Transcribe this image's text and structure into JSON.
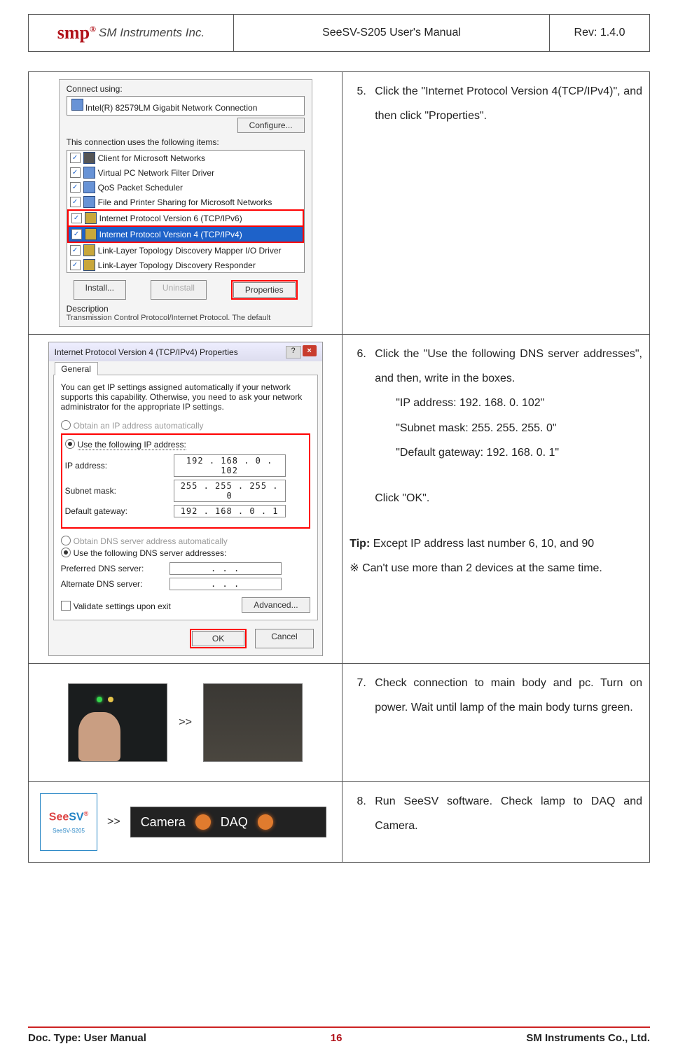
{
  "header": {
    "logo_brand": "smp",
    "logo_text": "SM Instruments Inc.",
    "title": "SeeSV-S205 User's Manual",
    "revision": "Rev: 1.4.0"
  },
  "dialog1": {
    "connect_using_label": "Connect using:",
    "adapter": "Intel(R) 82579LM Gigabit Network Connection",
    "configure_btn": "Configure...",
    "items_label": "This connection uses the following items:",
    "items": [
      "Client for Microsoft Networks",
      "Virtual PC Network Filter Driver",
      "QoS Packet Scheduler",
      "File and Printer Sharing for Microsoft Networks",
      "Internet Protocol Version 6 (TCP/IPv6)",
      "Internet Protocol Version 4 (TCP/IPv4)",
      "Link-Layer Topology Discovery Mapper I/O Driver",
      "Link-Layer Topology Discovery Responder"
    ],
    "install_btn": "Install...",
    "uninstall_btn": "Uninstall",
    "properties_btn": "Properties",
    "description_label": "Description",
    "description_text": "Transmission Control Protocol/Internet Protocol. The default"
  },
  "step5": {
    "num": "5.",
    "text": "Click the \"Internet Protocol Version 4(TCP/IPv4)\", and then click \"Properties\"."
  },
  "dialog2": {
    "title": "Internet Protocol Version 4 (TCP/IPv4) Properties",
    "tab": "General",
    "intro": "You can get IP settings assigned automatically if your network supports this capability. Otherwise, you need to ask your network administrator for the appropriate IP settings.",
    "obtain_ip": "Obtain an IP address automatically",
    "use_ip": "Use the following IP address:",
    "ip_label": "IP address:",
    "ip_value": "192 . 168 .  0   . 102",
    "subnet_label": "Subnet mask:",
    "subnet_value": "255 . 255 . 255 .  0",
    "gateway_label": "Default gateway:",
    "gateway_value": "192 . 168 .  0   .  1",
    "obtain_dns": "Obtain DNS server address automatically",
    "use_dns": "Use the following DNS server addresses:",
    "preferred_label": "Preferred DNS server:",
    "alternate_label": "Alternate DNS server:",
    "empty_ip": ".       .       .",
    "validate": "Validate settings upon exit",
    "advanced_btn": "Advanced...",
    "ok_btn": "OK",
    "cancel_btn": "Cancel"
  },
  "step6": {
    "num": "6.",
    "line1": "Click the \"Use the following DNS server addresses\", and then, write in the boxes.",
    "ip": "\"IP address: 192. 168. 0. 102\"",
    "subnet": "\"Subnet mask: 255. 255. 255. 0\"",
    "gateway": "\"Default gateway: 192. 168. 0. 1\"",
    "click_ok": "Click \"OK\".",
    "tip_label": "Tip:",
    "tip_text": " Except IP address last number 6, 10, and 90",
    "note": "※ Can't use more than 2 devices at the same time."
  },
  "step7": {
    "num": "7.",
    "arrows": ">>",
    "text": "Check connection to main body and pc. Turn on power. Wait until lamp of the main body turns green."
  },
  "step8": {
    "num": "8.",
    "arrows": ">>",
    "app_name_a": "See",
    "app_name_b": "SV",
    "app_sub": "SeeSV-S205",
    "camera": "Camera",
    "daq": "DAQ",
    "text": "Run SeeSV software. Check lamp to DAQ and Camera."
  },
  "footer": {
    "doc_type": "Doc. Type: User Manual",
    "page_no": "16",
    "company": "SM Instruments Co., Ltd."
  }
}
